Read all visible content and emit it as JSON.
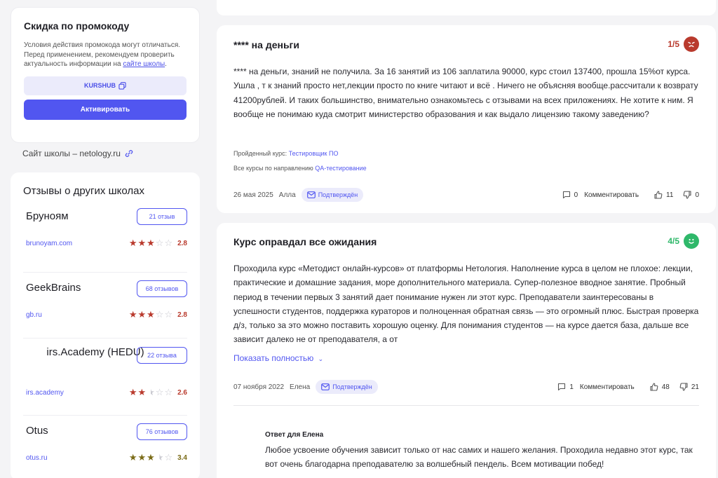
{
  "promo": {
    "title": "Скидка по промокоду",
    "text_start": "Условия действия промокода могут отличаться. Перед применением, рекомендуем проверить актуальность информации на ",
    "text_link": "сайте школы",
    "text_end": ".",
    "code": "KURSHUB",
    "button": "Активировать"
  },
  "site": {
    "label": "Сайт школы – netology.ru"
  },
  "others": {
    "title": "Отзывы о других школах",
    "schools": [
      {
        "name": "Бруноям",
        "count": "21 отзыв",
        "url": "brunoyam.com",
        "rating": 2.8,
        "score": "2.8"
      },
      {
        "name": "GeekBrains",
        "count": "68 отзывов",
        "url": "gb.ru",
        "rating": 2.8,
        "score": "2.8"
      },
      {
        "name": "irs.Academy (HEDU)",
        "count": "22 отзыва",
        "url": "irs.academy",
        "rating": 2.6,
        "score": "2.6"
      },
      {
        "name": "Otus",
        "count": "76 отзывов",
        "url": "otus.ru",
        "rating": 3.4,
        "score": "3.4"
      }
    ]
  },
  "reviews": [
    {
      "title": "**** на деньги",
      "rating": "1/5",
      "rating_color": "#b93a2d",
      "text": "**** на деньги, знаний не получила. За 16 занятий из 106 заплатила 90000, курс стоил 137400, прошла 15%от курса. Ушла , т к знаний просто нет,лекции просто по книге читают и всё . Ничего не объясняя вообще.рассчитали к возврату 41200рублей. И таких большинство, внимательно ознакомьтесь с отзывами на всех приложениях. Не хотите к ним. Я вообще не понимаю куда смотрит министерство образования и как выдало лицензию такому заведению?",
      "course_label": "Пройденный курс:",
      "course": "Тестировщик ПО",
      "direction_label": "Все курсы по направлению",
      "direction": "QA-тестирование",
      "date": "26 мая 2025",
      "author": "Алла",
      "badge": "Подтверждён",
      "comments": "0",
      "comment_label": "Комментировать",
      "likes": "11",
      "dislikes": "0"
    },
    {
      "title": "Курс оправдал все ожидания",
      "rating": "4/5",
      "rating_color": "#2fb86a",
      "text": "Проходила курс «Методист онлайн-курсов» от платформы Нетология. Наполнение курса в целом не плохое: лекции, практические и домашние задания, море дополнительного материала. Супер-полезное вводное занятие. Пробный период в течении первых 3 занятий дает понимание нужен ли этот курс. Преподаватели заинтересованы в успешности студентов, поддержка кураторов и полноценная обратная связь — это огромный плюс. Быстрая проверка д/з, только за это можно поставить хорошую оценку. Для понимания студентов — на курсе дается база, дальше все зависит далеко не от преподавателя, а от",
      "show_more": "Показать полностью",
      "date": "07 ноября 2022",
      "author": "Елена",
      "badge": "Подтверждён",
      "comments": "1",
      "comment_label": "Комментировать",
      "likes": "48",
      "dislikes": "21",
      "answer_title": "Ответ для Елена",
      "answer_text": "Любое усвоение обучения зависит только от нас самих и нашего желания. Проходила недавно этот курс, так вот очень благодарна преподавателю за волшебный пендель. Всем мотивации побед!"
    }
  ]
}
